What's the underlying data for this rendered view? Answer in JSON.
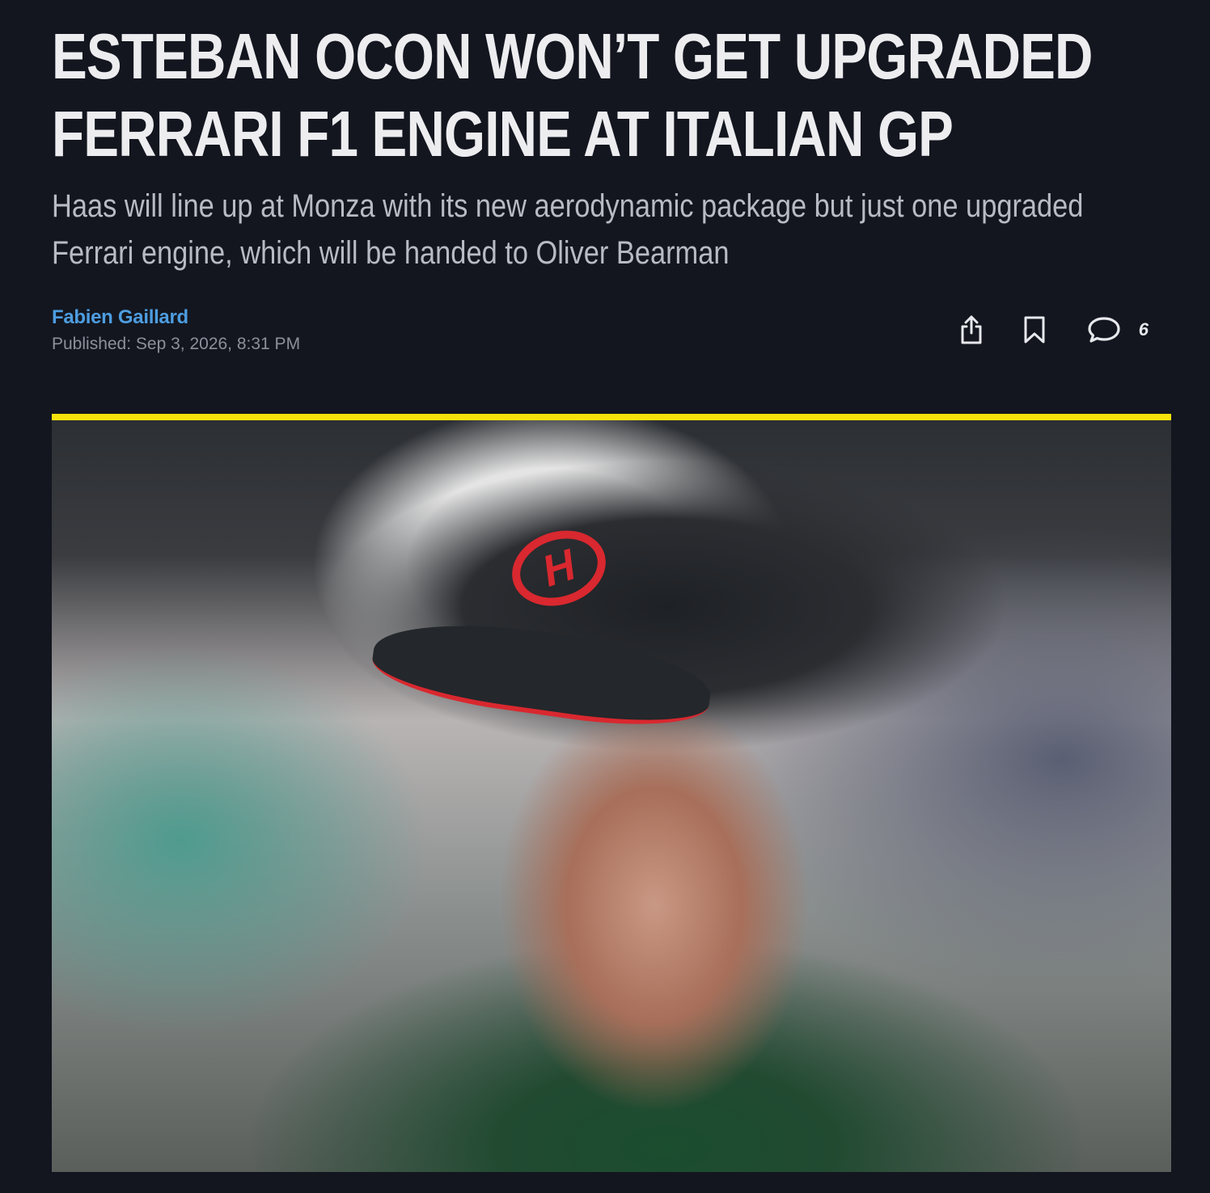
{
  "article": {
    "headline": "ESTEBAN OCON WON’T GET UPGRADED FERRARI F1 ENGINE AT ITALIAN GP",
    "standfirst": "Haas will line up at Monza with its new aerodynamic package but just one upgraded Ferrari engine, which will be handed to Oliver Bearman",
    "author": "Fabien Gaillard",
    "published_label": "Published:",
    "published_date": "Sep 3, 2026, 8:31 PM"
  },
  "actions": {
    "share_icon": "share-icon",
    "bookmark_icon": "bookmark-icon",
    "comment_icon": "comment-icon",
    "comment_count": "6"
  },
  "media": {
    "image_alt": "Esteban Ocon wearing a Haas cap",
    "accent_color": "#f6e20b"
  },
  "colors": {
    "background": "#13161f",
    "headline": "#ededf0",
    "standfirst": "#b8bbc4",
    "author": "#4d9de0",
    "meta": "#8d909a"
  }
}
